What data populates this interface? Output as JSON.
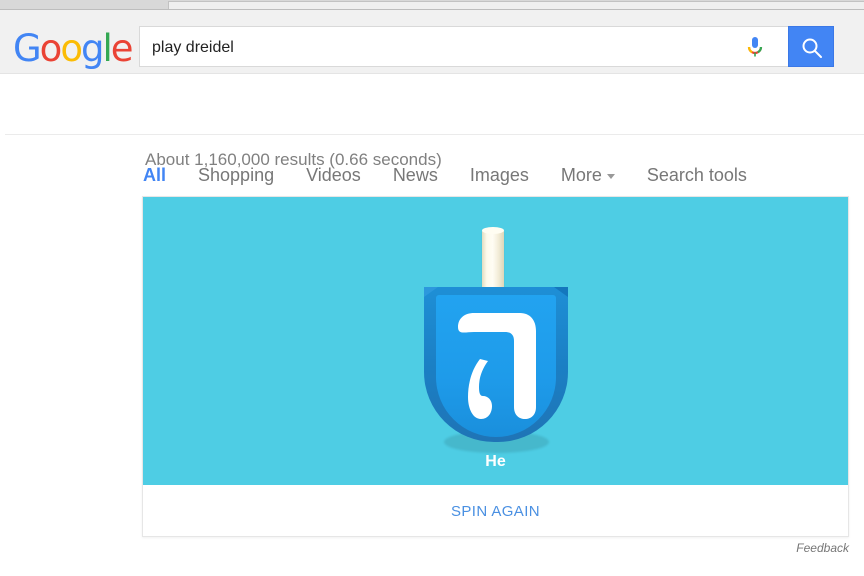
{
  "browser": {
    "chrome_visible": true
  },
  "header": {
    "logo": {
      "name": "Google",
      "letters": [
        {
          "char": "G",
          "color": "#4285f4"
        },
        {
          "char": "o",
          "color": "#ea4335"
        },
        {
          "char": "o",
          "color": "#fbbc05"
        },
        {
          "char": "g",
          "color": "#4285f4"
        },
        {
          "char": "l",
          "color": "#34a853"
        },
        {
          "char": "e",
          "color": "#ea4335"
        }
      ]
    },
    "search": {
      "value": "play dreidel",
      "placeholder": "Search",
      "mic_icon": "microphone-icon",
      "search_icon": "magnifier-icon",
      "button_color": "#4285f4"
    }
  },
  "nav": {
    "tabs": [
      {
        "label": "All",
        "active": true,
        "has_caret": false
      },
      {
        "label": "Shopping",
        "active": false,
        "has_caret": false
      },
      {
        "label": "Videos",
        "active": false,
        "has_caret": false
      },
      {
        "label": "News",
        "active": false,
        "has_caret": false
      },
      {
        "label": "Images",
        "active": false,
        "has_caret": false
      },
      {
        "label": "More",
        "active": false,
        "has_caret": true
      },
      {
        "label": "Search tools",
        "active": false,
        "has_caret": false
      }
    ],
    "active_color": "#4285f4"
  },
  "results": {
    "stats": "About 1,160,000 results (0.66 seconds)"
  },
  "dreidel_widget": {
    "stage_color": "#4ecde4",
    "hebrew_letter": "ה",
    "letter_label": "He",
    "spin_label": "SPIN AGAIN",
    "spin_color": "#4a90e2",
    "dreidel_body_color": "#22a3f0",
    "dreidel_shade_color": "#1b7fc4",
    "dreidel_stem_color": "#fffdf2"
  },
  "footer": {
    "feedback_label": "Feedback"
  }
}
